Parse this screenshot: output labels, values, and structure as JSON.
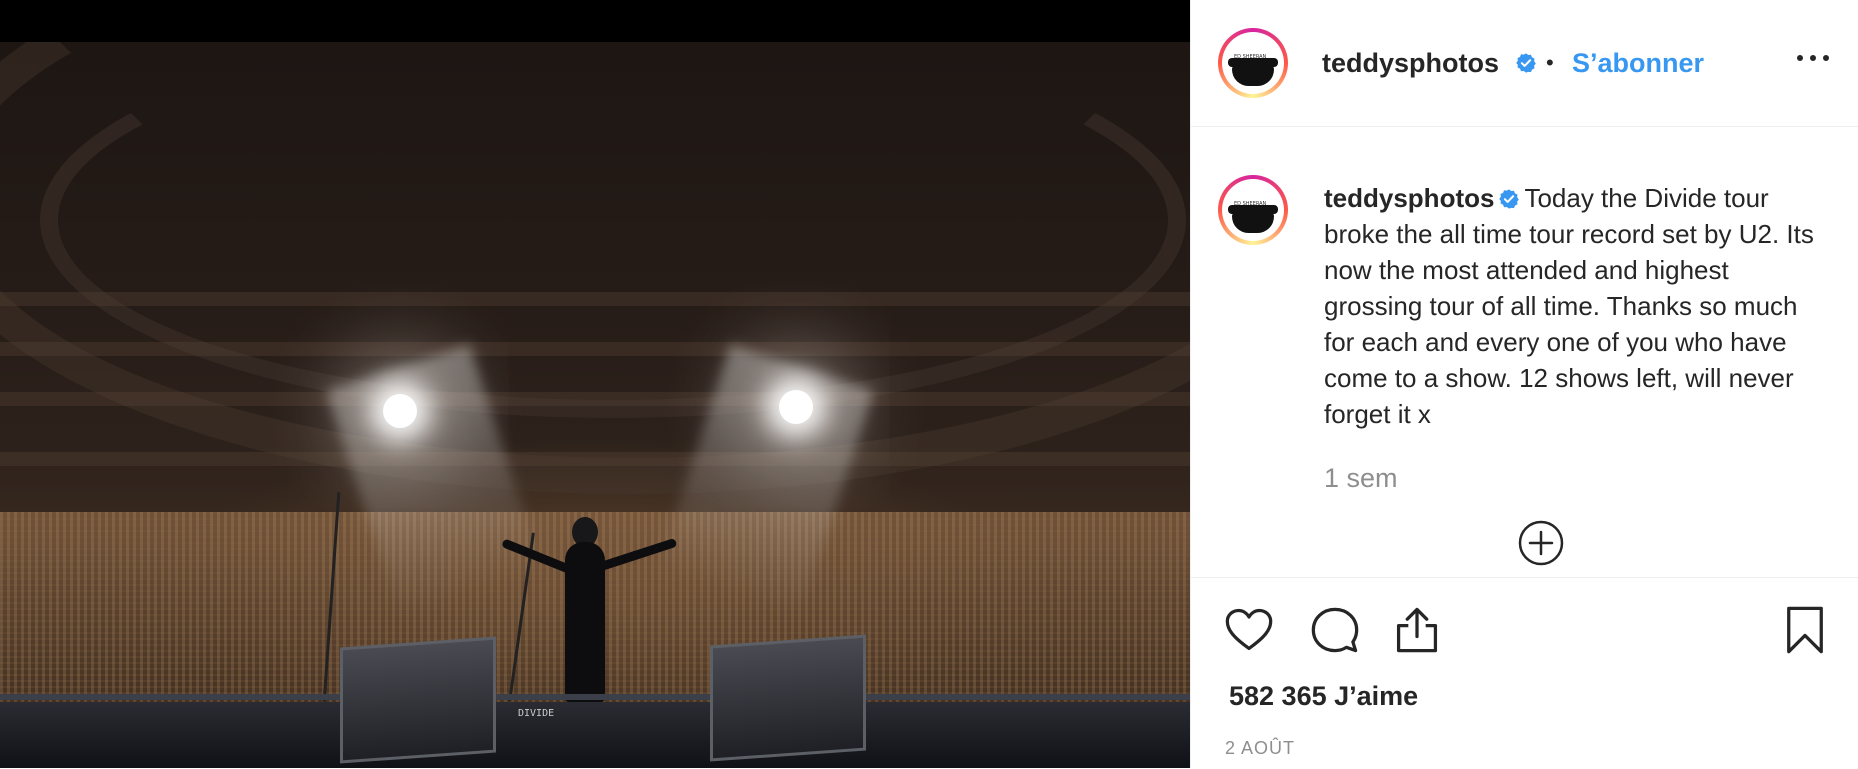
{
  "post": {
    "author": "teddysphotos",
    "follow_label": "S’abonner",
    "separator": "•",
    "caption_author": "teddysphotos",
    "caption_text": "Today the Divide tour broke the all time tour record set by U2. Its now the most attended and highest grossing tour of all time. Thanks so much for each and every one of you who have come to a show. 12 shows left, will never forget it x",
    "caption_time": "1 sem",
    "likes": "582 365 J’aime",
    "date": "2 AOÛT",
    "avatar_text": "ED SHEERAN",
    "equipment_label": "DIVIDE"
  },
  "icons": {
    "verified": "verified-badge-icon",
    "more": "more-options-icon",
    "load_more": "load-more-comments-icon",
    "like": "heart-icon",
    "comment": "comment-icon",
    "share": "share-icon",
    "save": "bookmark-icon"
  },
  "colors": {
    "accent": "#3897f0",
    "text": "#262626",
    "muted": "#8e8e8e"
  }
}
